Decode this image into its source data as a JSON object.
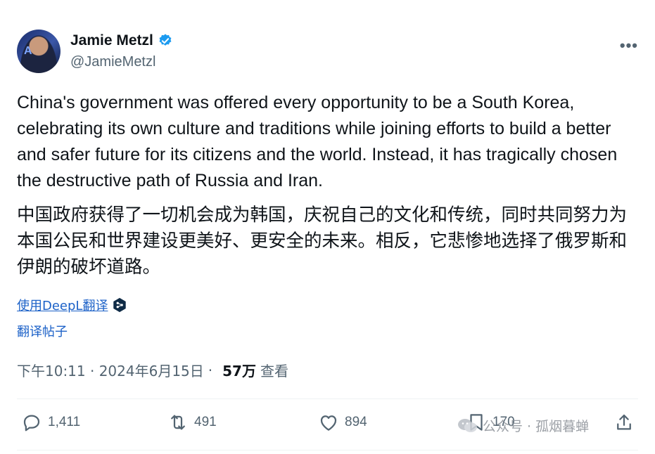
{
  "author": {
    "display_name": "Jamie Metzl",
    "handle": "@JamieMetzl"
  },
  "tweet": {
    "text_en": "China's government was offered every opportunity to be a South Korea, celebrating its own culture and traditions while joining efforts to build a better and safer future for its citizens and the world. Instead, it has tragically chosen the destructive path of Russia and Iran.",
    "text_zh": "中国政府获得了一切机会成为韩国，庆祝自己的文化和传统，同时共同努力为本国公民和世界建设更美好、更安全的未来。相反，它悲惨地选择了俄罗斯和伊朗的破坏道路。"
  },
  "translation": {
    "deepl_label": "使用DeepL翻译",
    "translate_post_label": "翻译帖子"
  },
  "meta": {
    "timestamp": "下午10:11 · 2024年6月15日",
    "separator": "·",
    "views_count": "57万",
    "views_label": "查看"
  },
  "actions": {
    "replies": "1,411",
    "retweets": "491",
    "likes": "894",
    "bookmarks": "170"
  },
  "watermark": {
    "text": "公众号 · 孤烟暮蝉"
  },
  "colors": {
    "verified": "#1d9bf0",
    "link": "#1d62c8",
    "secondary_text": "#536471"
  },
  "icons": [
    "verified-badge-icon",
    "more-icon",
    "deepl-icon",
    "reply-icon",
    "retweet-icon",
    "like-icon",
    "bookmark-icon",
    "share-icon",
    "wechat-icon"
  ]
}
